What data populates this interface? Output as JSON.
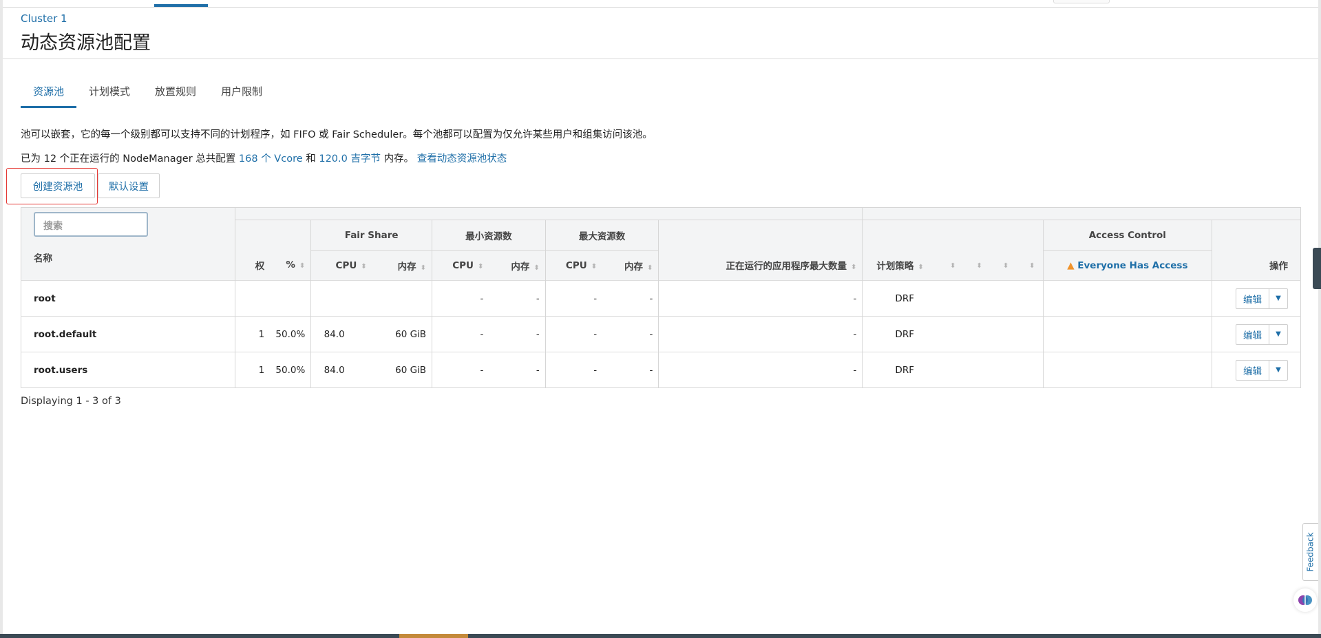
{
  "breadcrumb": "Cluster 1",
  "page_title": "动态资源池配置",
  "tabs": [
    {
      "label": "资源池",
      "active": true
    },
    {
      "label": "计划模式",
      "active": false
    },
    {
      "label": "放置规则",
      "active": false
    },
    {
      "label": "用户限制",
      "active": false
    }
  ],
  "description": "池可以嵌套，它的每一个级别都可以支持不同的计划程序，如 FIFO 或 Fair Scheduler。每个池都可以配置为仅允许某些用户和组集访问该池。",
  "summary": {
    "prefix": "已为 12 个正在运行的 NodeManager 总共配置",
    "vcore_link": "168 个 Vcore",
    "and": "和",
    "memory_link": "120.0 吉字节",
    "suffix": "内存。",
    "status_link": "查看动态资源池状态"
  },
  "buttons": {
    "create_pool": "创建资源池",
    "default_settings": "默认设置"
  },
  "table": {
    "search_placeholder": "搜索",
    "group_headers": {
      "fair_share": "Fair Share",
      "min_resources": "最小资源数",
      "max_resources": "最大资源数",
      "access_control": "Access Control"
    },
    "columns": {
      "name": "名称",
      "weight": "权",
      "percent": "%",
      "cpu": "CPU",
      "memory": "内存",
      "max_apps": "正在运行的应用程序最大数量",
      "policy": "计划策略",
      "access": "Everyone Has Access",
      "actions": "操作"
    },
    "rows": [
      {
        "name": "root",
        "weight": "",
        "percent": "",
        "fs_cpu": "",
        "fs_mem": "",
        "min_cpu": "-",
        "min_mem": "-",
        "max_cpu": "-",
        "max_mem": "-",
        "max_apps": "-",
        "policy": "DRF",
        "edit": "编辑"
      },
      {
        "name": "root.default",
        "weight": "1",
        "percent": "50.0%",
        "fs_cpu": "84.0",
        "fs_mem": "60 GiB",
        "min_cpu": "-",
        "min_mem": "-",
        "max_cpu": "-",
        "max_mem": "-",
        "max_apps": "-",
        "policy": "DRF",
        "edit": "编辑"
      },
      {
        "name": "root.users",
        "weight": "1",
        "percent": "50.0%",
        "fs_cpu": "84.0",
        "fs_mem": "60 GiB",
        "min_cpu": "-",
        "min_mem": "-",
        "max_cpu": "-",
        "max_mem": "-",
        "max_apps": "-",
        "policy": "DRF",
        "edit": "编辑"
      }
    ]
  },
  "footer": {
    "displaying": "Displaying 1 - 3 of 3"
  },
  "feedback_label": "Feedback",
  "colors": {
    "accent": "#1f6fa8",
    "warning": "#f0932b",
    "highlight": "#e53935"
  }
}
